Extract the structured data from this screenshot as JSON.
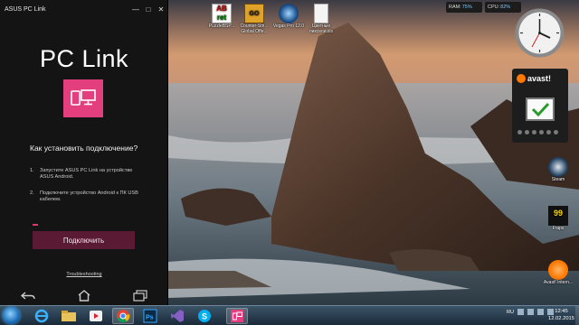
{
  "pclink": {
    "window_title": "ASUS PC Link",
    "app_title": "PC Link",
    "question": "Как установить подключение?",
    "steps": [
      {
        "num": "1.",
        "text": "Запустите ASUS PC Link на устройстве ASUS Android."
      },
      {
        "num": "2.",
        "text": "Подключите устройство Android к ПК USB кабелем."
      }
    ],
    "connect_label": "Подключить",
    "troubleshoot_label": "Troubleshooting",
    "accent": "#e33f7e"
  },
  "desktop_icons": [
    {
      "label": "PuzzleBSP...",
      "icon": "abc-word-icon"
    },
    {
      "label": "Counter-Stri... Global Offe...",
      "icon": "csgo-icon"
    },
    {
      "label": "Vegas Pro 12.0",
      "icon": "vegas-icon"
    },
    {
      "label": "Цветные пиксели.xls",
      "icon": "document-icon"
    },
    {
      "label": "Steam",
      "icon": "steam-icon"
    },
    {
      "label": "Fraps",
      "icon": "fraps-icon"
    },
    {
      "label": "Avast! Intern...",
      "icon": "avast-icon"
    }
  ],
  "gadgets": {
    "ram_label": "RAM:",
    "ram_value": "75%",
    "cpu_label": "CPU:",
    "cpu_value": "82%",
    "avast_name": "avast!"
  },
  "taskbar": {
    "time": "12:45",
    "date": "12.02.2015",
    "language": "RU",
    "apps": [
      "ie-icon",
      "explorer-icon",
      "media-player-icon",
      "chrome-icon",
      "photoshop-icon",
      "visual-studio-icon",
      "skype-icon",
      "pclink-icon"
    ]
  }
}
